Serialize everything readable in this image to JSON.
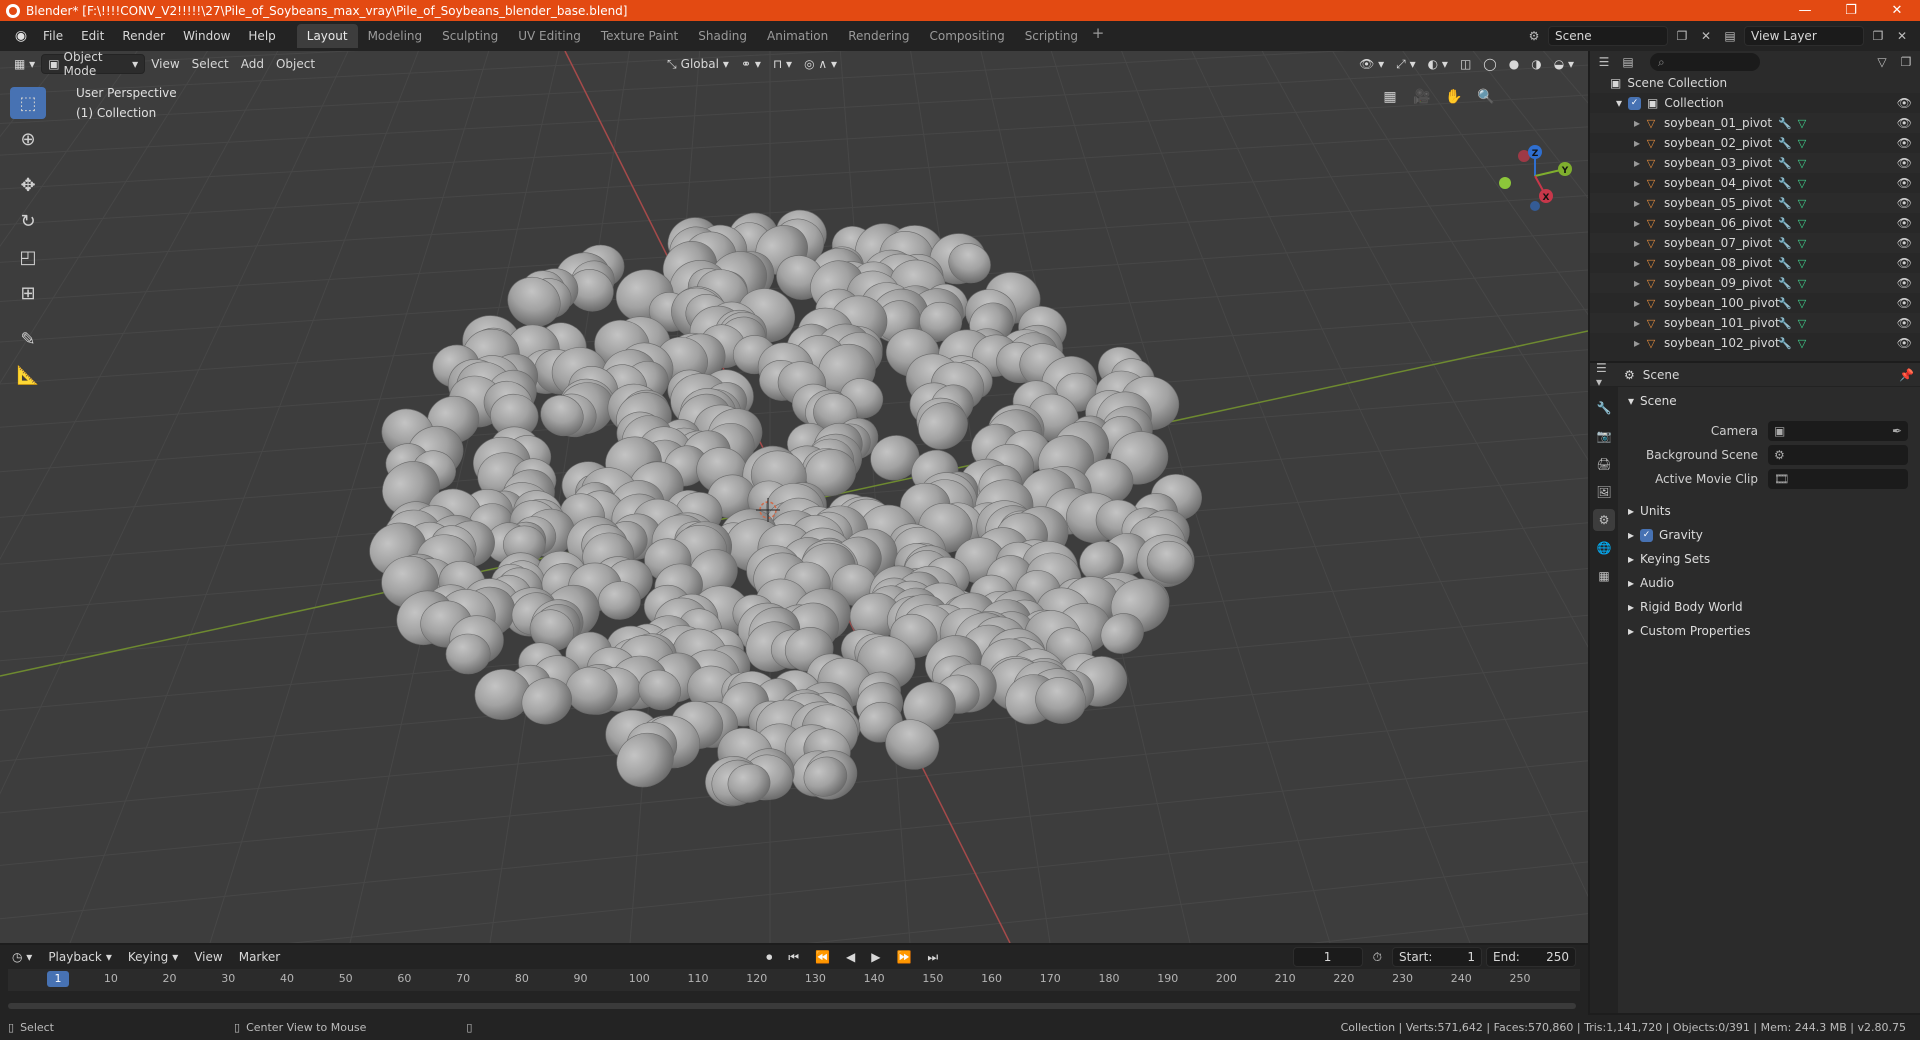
{
  "window": {
    "title": "Blender* [F:\\!!!!CONV_V2!!!!!\\27\\Pile_of_Soybeans_max_vray\\Pile_of_Soybeans_blender_base.blend]",
    "minimize": "—",
    "maximize": "❐",
    "close": "✕"
  },
  "menu": [
    "File",
    "Edit",
    "Render",
    "Window",
    "Help"
  ],
  "workspaces": [
    "Layout",
    "Modeling",
    "Sculpting",
    "UV Editing",
    "Texture Paint",
    "Shading",
    "Animation",
    "Rendering",
    "Compositing",
    "Scripting"
  ],
  "active_workspace": "Layout",
  "scene_field": "Scene",
  "view_layer_field": "View Layer",
  "viewport": {
    "mode": "Object Mode",
    "menus": [
      "View",
      "Select",
      "Add",
      "Object"
    ],
    "transform_orientation": "Global",
    "info_line1": "User Perspective",
    "info_line2": "(1) Collection",
    "axis_x": "X",
    "axis_y": "Y",
    "axis_z": "Z"
  },
  "outliner": {
    "root": "Scene Collection",
    "collection": "Collection",
    "items": [
      "soybean_01_pivot",
      "soybean_02_pivot",
      "soybean_03_pivot",
      "soybean_04_pivot",
      "soybean_05_pivot",
      "soybean_06_pivot",
      "soybean_07_pivot",
      "soybean_08_pivot",
      "soybean_09_pivot",
      "soybean_100_pivot",
      "soybean_101_pivot",
      "soybean_102_pivot"
    ]
  },
  "properties": {
    "context": "Scene",
    "panel": "Scene",
    "camera_label": "Camera",
    "background_scene_label": "Background Scene",
    "active_movie_clip_label": "Active Movie Clip",
    "sections": [
      "Units",
      "Gravity",
      "Keying Sets",
      "Audio",
      "Rigid Body World",
      "Custom Properties"
    ]
  },
  "timeline": {
    "menus": [
      "Playback",
      "Keying",
      "View",
      "Marker"
    ],
    "current_frame": "1",
    "start_label": "Start:",
    "start": "1",
    "end_label": "End:",
    "end": "250",
    "ticks": [
      "1",
      "10",
      "20",
      "30",
      "40",
      "50",
      "60",
      "70",
      "80",
      "90",
      "100",
      "110",
      "120",
      "130",
      "140",
      "150",
      "160",
      "170",
      "180",
      "190",
      "200",
      "210",
      "220",
      "230",
      "240",
      "250"
    ]
  },
  "status": {
    "left1": "Select",
    "left2": "Center View to Mouse",
    "right": "Collection | Verts:571,642 | Faces:570,860 | Tris:1,141,720 | Objects:0/391 | Mem: 244.3 MB | v2.80.75"
  }
}
